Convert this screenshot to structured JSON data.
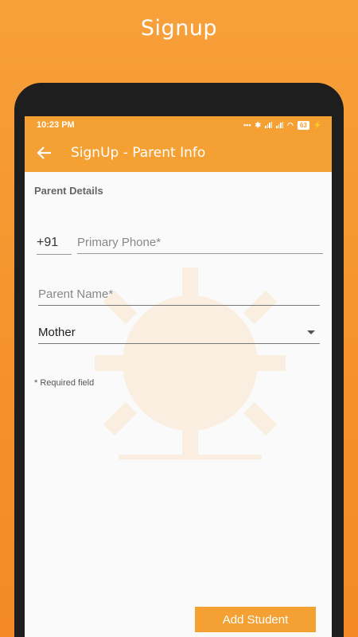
{
  "promo": {
    "title": "Signup"
  },
  "status_bar": {
    "time": "10:23 PM",
    "battery": "63"
  },
  "app_bar": {
    "title": "SignUp - Parent Info"
  },
  "form": {
    "section_label": "Parent Details",
    "country_code": "+91",
    "phone_placeholder": "Primary Phone*",
    "name_placeholder": "Parent Name*",
    "relation_value": "Mother",
    "required_note": "* Required field"
  },
  "actions": {
    "add_student_label": "Add Student"
  },
  "colors": {
    "accent": "#f5a033",
    "background": "#fafafa"
  }
}
